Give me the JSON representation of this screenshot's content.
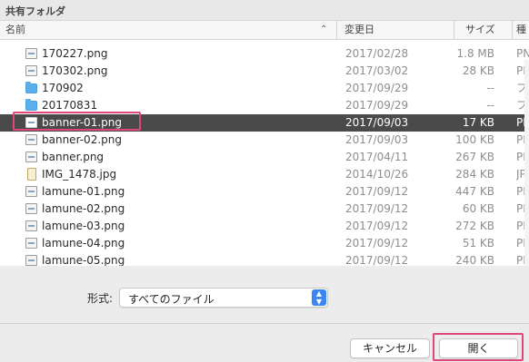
{
  "window": {
    "title": "共有フォルダ"
  },
  "columns": {
    "name": "名前",
    "date": "変更日",
    "size": "サイズ",
    "kind": "種類"
  },
  "files": [
    {
      "name": "170227.png",
      "date": "2017/02/28",
      "size": "1.8 MB",
      "kind": "PNG",
      "icon": "image-file-icon",
      "dim": false,
      "selected": false
    },
    {
      "name": "170302.png",
      "date": "2017/03/02",
      "size": "28 KB",
      "kind": "PNG",
      "icon": "image-file-icon",
      "dim": false,
      "selected": false
    },
    {
      "name": "170902",
      "date": "2017/09/29",
      "size": "--",
      "kind": "フォルダ",
      "icon": "folder-icon",
      "dim": false,
      "selected": false
    },
    {
      "name": "20170831",
      "date": "2017/09/29",
      "size": "--",
      "kind": "フォルダ",
      "icon": "folder-icon",
      "dim": false,
      "selected": false
    },
    {
      "name": "banner-01.png",
      "date": "2017/09/03",
      "size": "17 KB",
      "kind": "PNG",
      "icon": "image-file-icon",
      "dim": false,
      "selected": true
    },
    {
      "name": "banner-02.png",
      "date": "2017/09/03",
      "size": "100 KB",
      "kind": "PNG",
      "icon": "image-file-icon",
      "dim": false,
      "selected": false
    },
    {
      "name": "banner.png",
      "date": "2017/04/11",
      "size": "267 KB",
      "kind": "PNG",
      "icon": "image-file-icon",
      "dim": false,
      "selected": false
    },
    {
      "name": "IMG_1478.jpg",
      "date": "2014/10/26",
      "size": "284 KB",
      "kind": "JPEG",
      "icon": "portrait-image-icon",
      "dim": false,
      "selected": false
    },
    {
      "name": "lamune-01.png",
      "date": "2017/09/12",
      "size": "447 KB",
      "kind": "PNG",
      "icon": "image-file-icon",
      "dim": false,
      "selected": false
    },
    {
      "name": "lamune-02.png",
      "date": "2017/09/12",
      "size": "60 KB",
      "kind": "PNG",
      "icon": "image-file-icon",
      "dim": false,
      "selected": false
    },
    {
      "name": "lamune-03.png",
      "date": "2017/09/12",
      "size": "272 KB",
      "kind": "PNG",
      "icon": "image-file-icon",
      "dim": false,
      "selected": false
    },
    {
      "name": "lamune-04.png",
      "date": "2017/09/12",
      "size": "51 KB",
      "kind": "PNG",
      "icon": "image-file-icon",
      "dim": false,
      "selected": false
    },
    {
      "name": "lamune-05.png",
      "date": "2017/09/12",
      "size": "240 KB",
      "kind": "PNG",
      "icon": "image-file-icon",
      "dim": false,
      "selected": false
    }
  ],
  "format": {
    "label": "形式:",
    "value": "すべてのファイル"
  },
  "buttons": {
    "cancel": "キャンセル",
    "open": "開く"
  },
  "colors": {
    "highlight": "#e0457b",
    "selected_row": "#4a4a4a",
    "accent": "#3b86f5",
    "folder": "#5bb0ec"
  }
}
